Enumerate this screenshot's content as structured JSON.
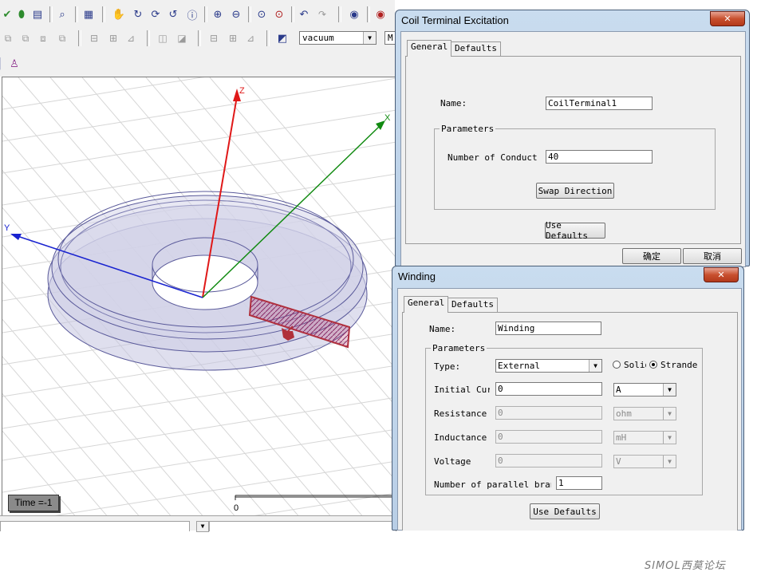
{
  "toolbar": {
    "material_value": "vacuum",
    "material_trunc": "M"
  },
  "viewport": {
    "axis_z": "Z",
    "axis_x": "X",
    "axis_y": "Y",
    "time_label": "Time =-1",
    "ruler_zero": "0"
  },
  "coil_dialog": {
    "title": "Coil Terminal Excitation",
    "close_label": "✕",
    "tabs": [
      "General",
      "Defaults"
    ],
    "name_label": "Name:",
    "name_value": "CoilTerminal1",
    "group_label": "Parameters",
    "conductors_label": "Number of Conductors",
    "conductors_value": "40",
    "swap_button": "Swap Direction",
    "use_defaults_button": "Use Defaults",
    "ok_button": "确定",
    "cancel_button": "取消"
  },
  "winding_dialog": {
    "title": "Winding",
    "close_label": "✕",
    "tabs": [
      "General",
      "Defaults"
    ],
    "name_label": "Name:",
    "name_value": "Winding",
    "group_label": "Parameters",
    "type_label": "Type:",
    "type_value": "External",
    "solid_label": "Solid",
    "stranded_label": "Stranded",
    "current_label": "Initial Current",
    "current_value": "0",
    "current_unit": "A",
    "resistance_label": "Resistance",
    "resistance_value": "0",
    "resistance_unit": "ohm",
    "inductance_label": "Inductance",
    "inductance_value": "0",
    "inductance_unit": "mH",
    "voltage_label": "Voltage",
    "voltage_value": "0",
    "voltage_unit": "V",
    "branches_label": "Number of parallel branches",
    "branches_value": "1",
    "use_defaults_button": "Use Defaults"
  },
  "watermark": {
    "text": "SIMOL西莫论坛"
  }
}
